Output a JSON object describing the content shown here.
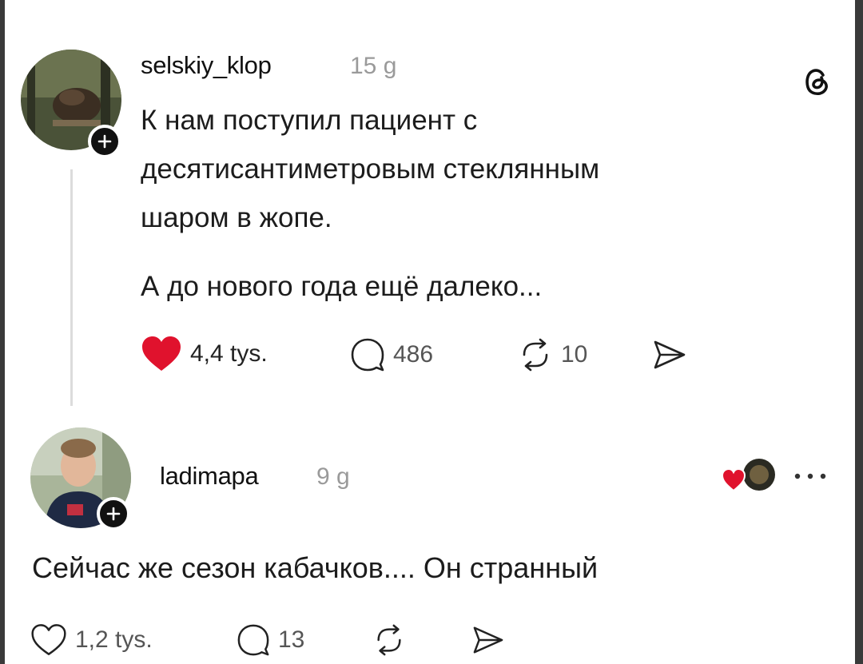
{
  "post": {
    "username": "selskiy_klop",
    "time": "15 g",
    "lines": [
      "К нам поступил пациент с",
      "десятисантиметровым стеклянным",
      "шаром в жопе."
    ],
    "paragraph2": "А до нового года ещё далеко...",
    "likes": "4,4 tys.",
    "comments": "486",
    "reposts": "10"
  },
  "reply": {
    "username": "ladimapa",
    "time": "9 g",
    "text": "Сейчас же сезон кабачков.... Он странный",
    "likes": "1,2 tys.",
    "comments": "13"
  },
  "colors": {
    "like_red": "#e0122d",
    "badge_dark": "#111111"
  },
  "icons": [
    "threads-logo-icon",
    "plus-icon",
    "heart-icon",
    "comment-icon",
    "repost-icon",
    "share-icon",
    "more-icon",
    "liked-by-author-icon"
  ]
}
